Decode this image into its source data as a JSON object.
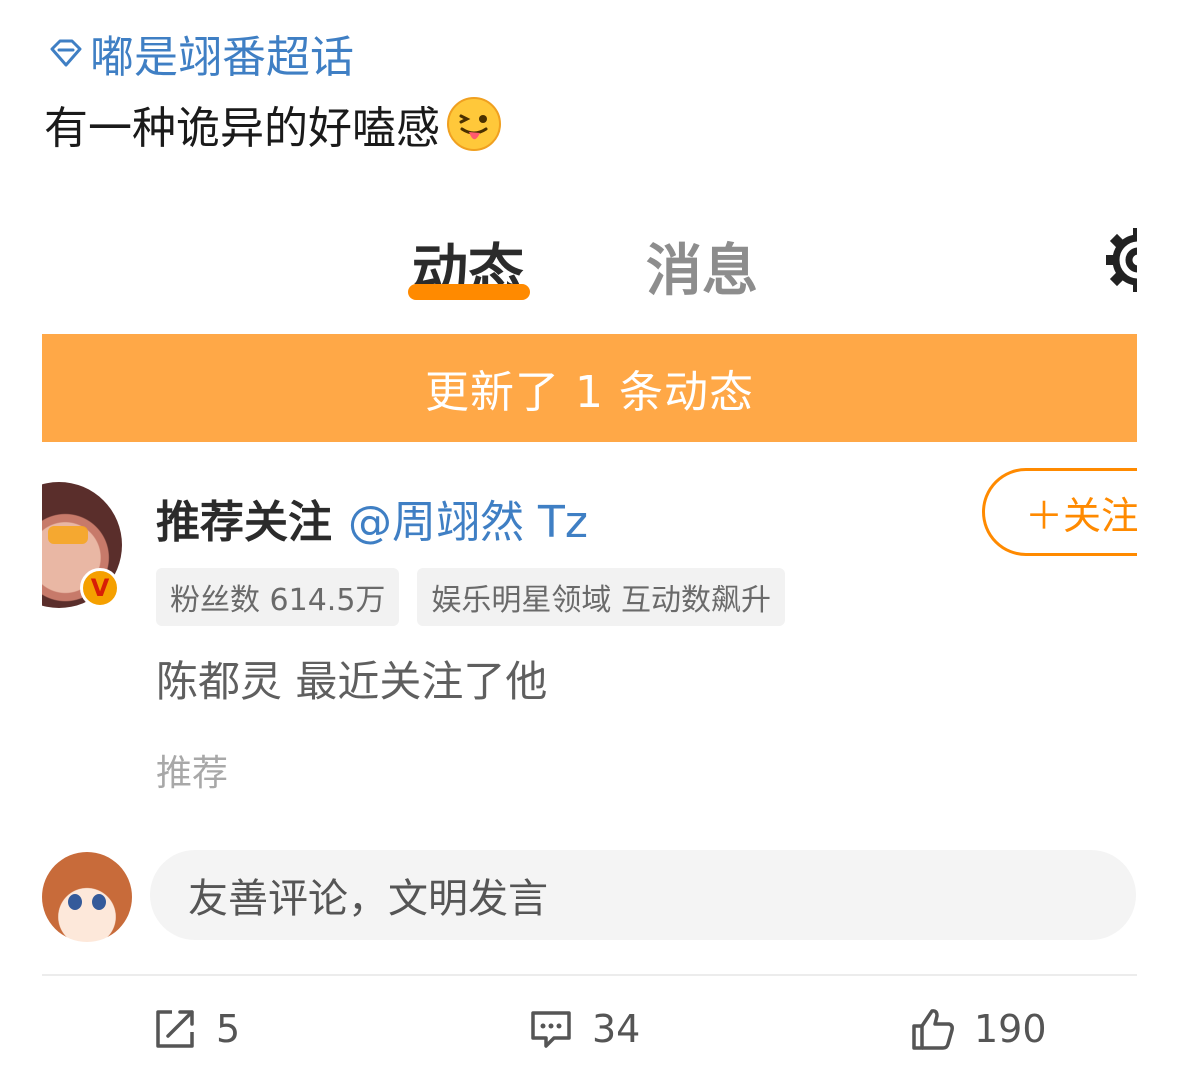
{
  "topic": {
    "label": "嘟是翊番超话",
    "icon": "diamond-icon",
    "color": "#3f7fc4"
  },
  "caption": {
    "text": "有一种诡异的好嗑感",
    "emoji": "tongue-out-emoji"
  },
  "screenshot": {
    "tabs": [
      {
        "label": "动态",
        "active": true
      },
      {
        "label": "消息",
        "active": false
      }
    ],
    "settings_icon": "gear-icon",
    "banner": {
      "text": "更新了 1 条动态",
      "color": "#ffa847"
    },
    "recommendation": {
      "prefix": "推荐关注",
      "user": "@周翊然 Tz",
      "follow_button": "＋关注",
      "tags": [
        "粉丝数 614.5万",
        "娱乐明星领域 互动数飙升"
      ],
      "description": "陈都灵 最近关注了他",
      "type": "推荐",
      "verified_badge": "V"
    }
  },
  "comment_box": {
    "placeholder": "友善评论，文明发言"
  },
  "actions": {
    "share_count": "5",
    "comment_count": "34",
    "like_count": "190"
  }
}
